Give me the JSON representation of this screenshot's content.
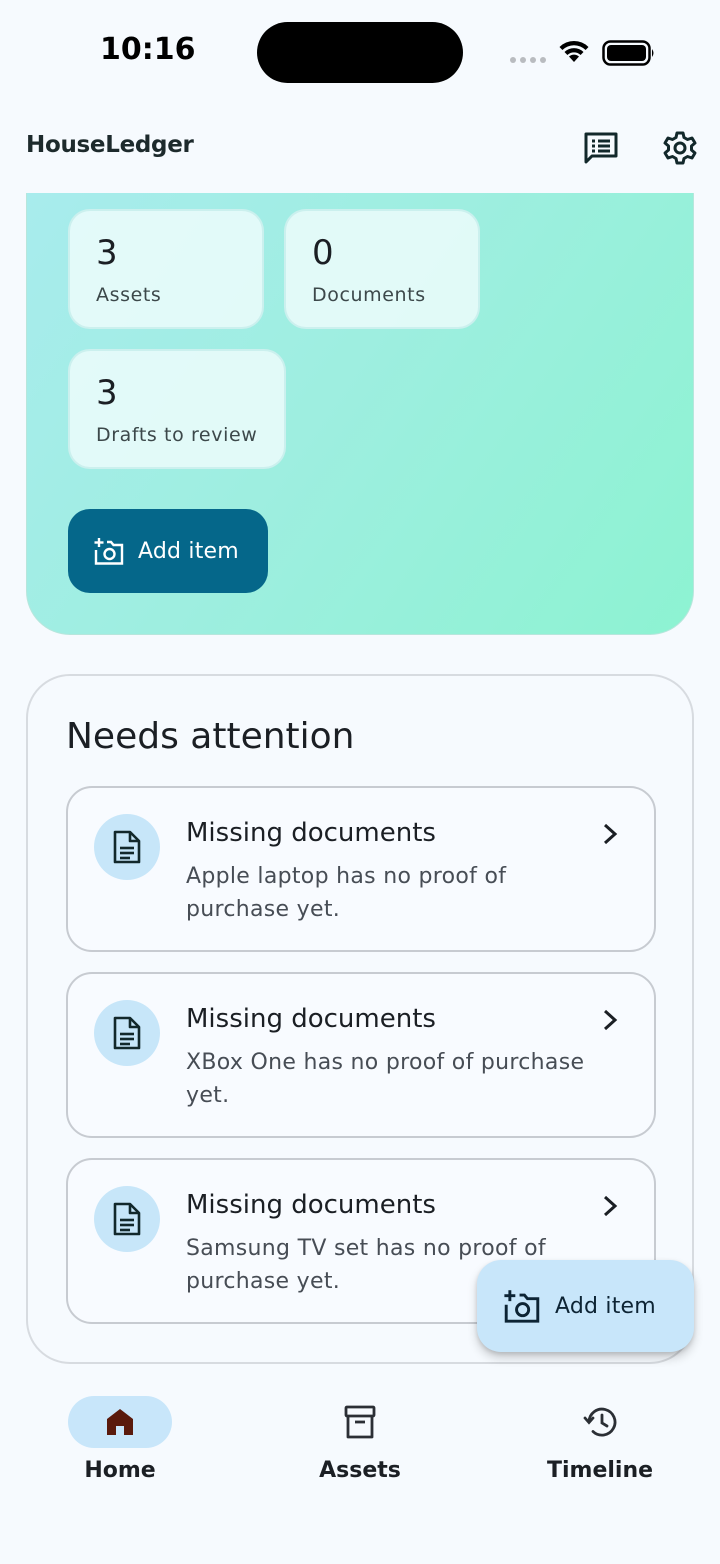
{
  "status_bar": {
    "time": "10:16"
  },
  "header": {
    "title": "HouseLedger",
    "feedback_icon": "feedback-icon",
    "settings_icon": "gear-icon"
  },
  "hero": {
    "stats": [
      {
        "value": "3",
        "label": "Assets"
      },
      {
        "value": "0",
        "label": "Documents"
      },
      {
        "value": "3",
        "label": "Drafts to review"
      }
    ],
    "add_button_label": "Add item"
  },
  "attention": {
    "title": "Needs attention",
    "items": [
      {
        "title": "Missing documents",
        "subtitle": "Apple laptop has no proof of purchase yet."
      },
      {
        "title": "Missing documents",
        "subtitle": "XBox One has no proof of purchase yet."
      },
      {
        "title": "Missing documents",
        "subtitle": "Samsung TV set has no proof of purchase yet."
      }
    ]
  },
  "fab": {
    "label": "Add item"
  },
  "bottom_nav": {
    "items": [
      {
        "label": "Home",
        "icon": "home-icon",
        "active": true
      },
      {
        "label": "Assets",
        "icon": "archive-icon",
        "active": false
      },
      {
        "label": "Timeline",
        "icon": "history-icon",
        "active": false
      }
    ]
  },
  "colors": {
    "primary": "#05678a",
    "fab_bg": "#c8e6fa",
    "hero_gradient_start": "#a8eced",
    "hero_gradient_end": "#8df3d2",
    "home_icon": "#5a1a0c"
  }
}
